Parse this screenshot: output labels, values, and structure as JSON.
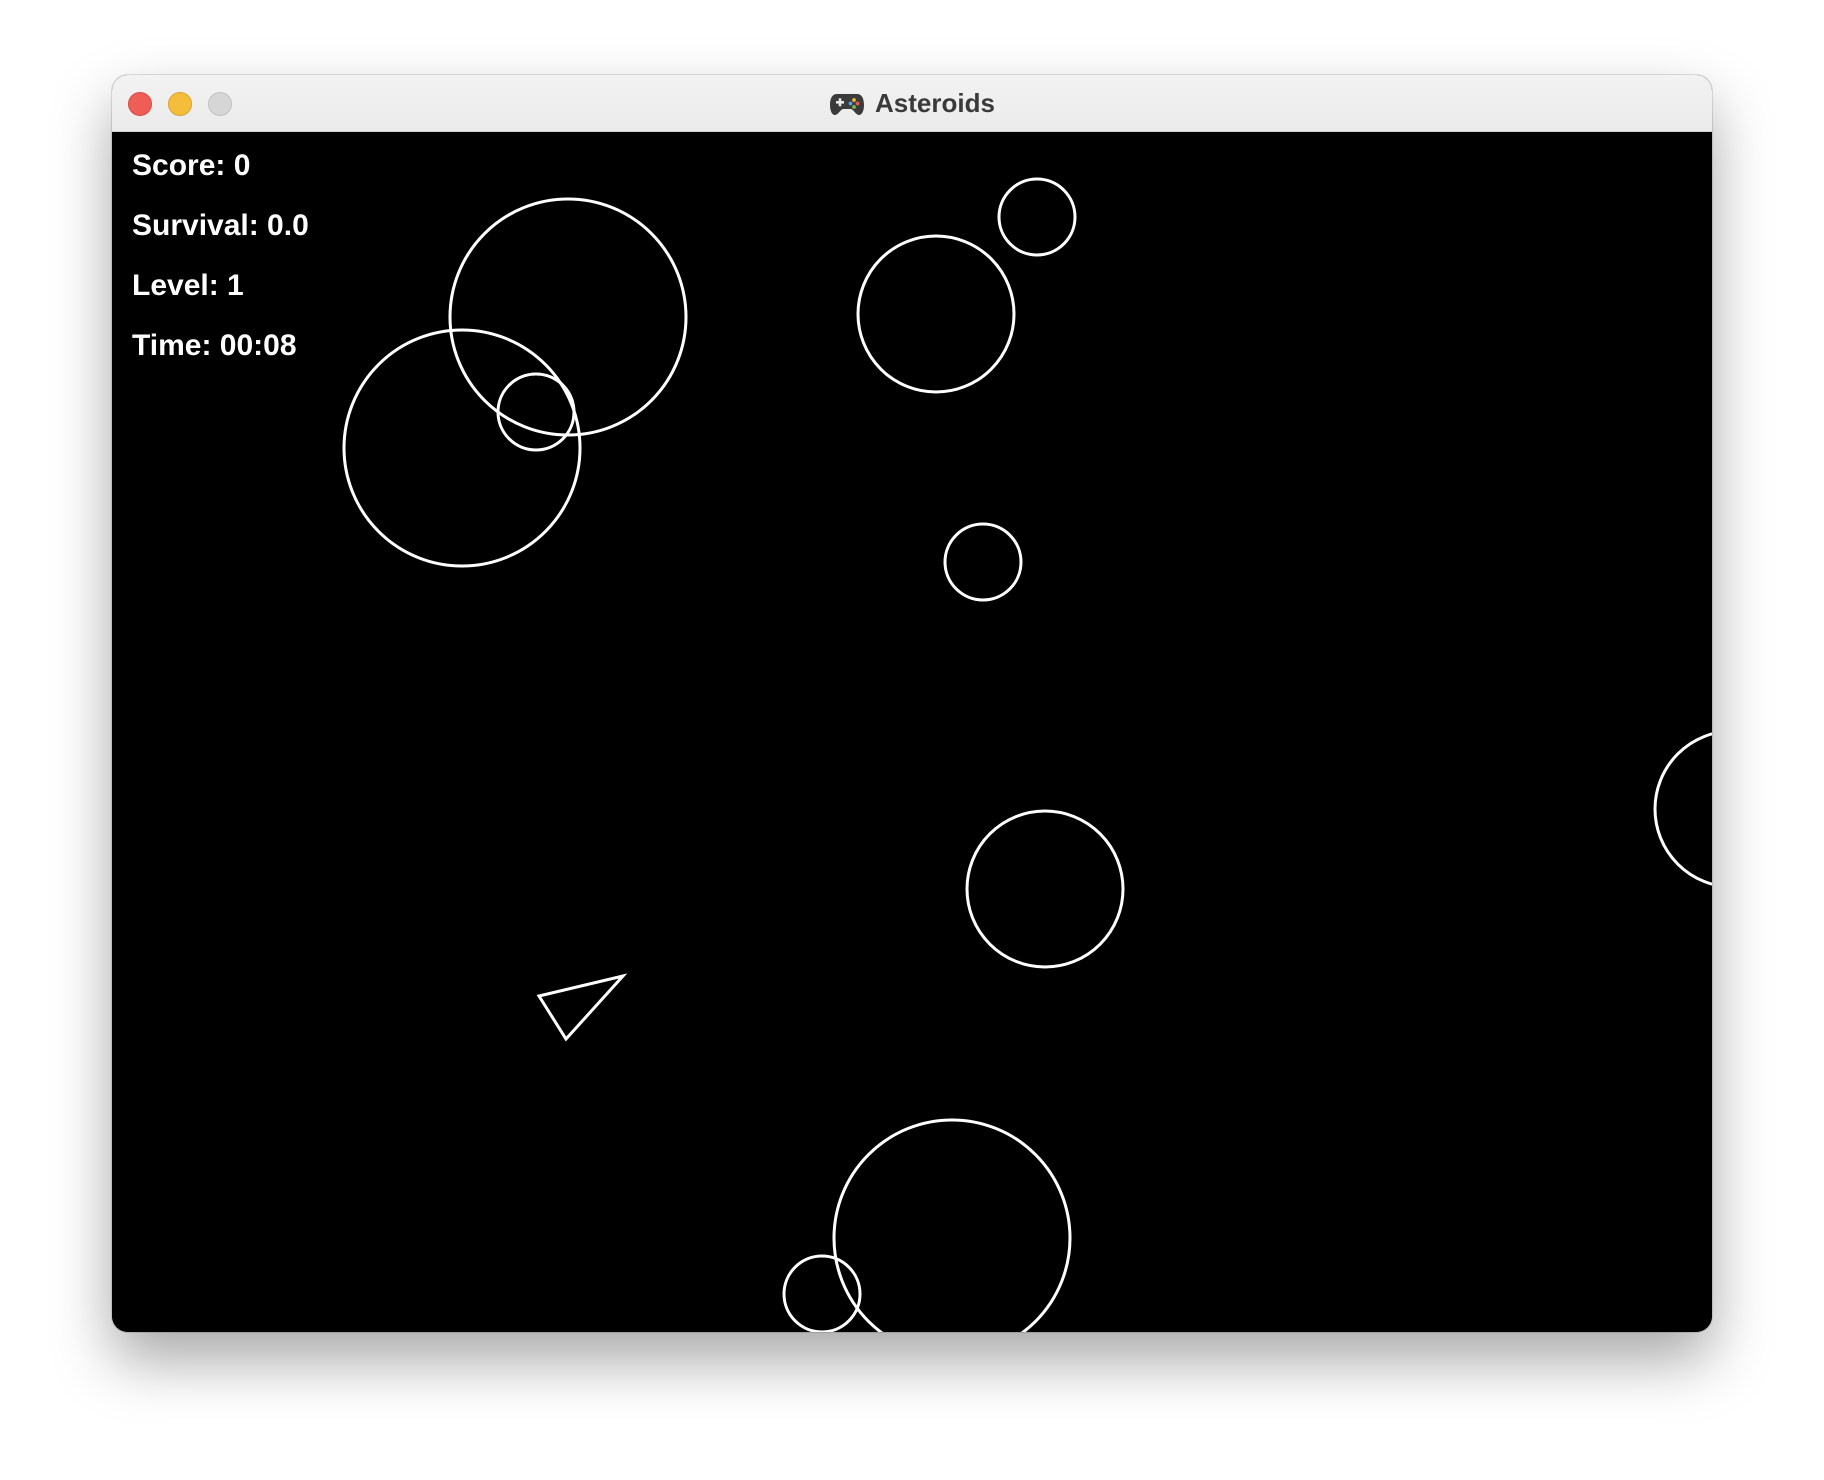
{
  "window": {
    "title": "Asteroids",
    "title_icon": "gamepad-icon"
  },
  "hud": {
    "score_label": "Score: 0",
    "survival_label": "Survival: 0.0",
    "level_label": "Level: 1",
    "time_label": "Time: 00:08"
  },
  "colors": {
    "background": "#000000",
    "stroke": "#ffffff"
  }
}
